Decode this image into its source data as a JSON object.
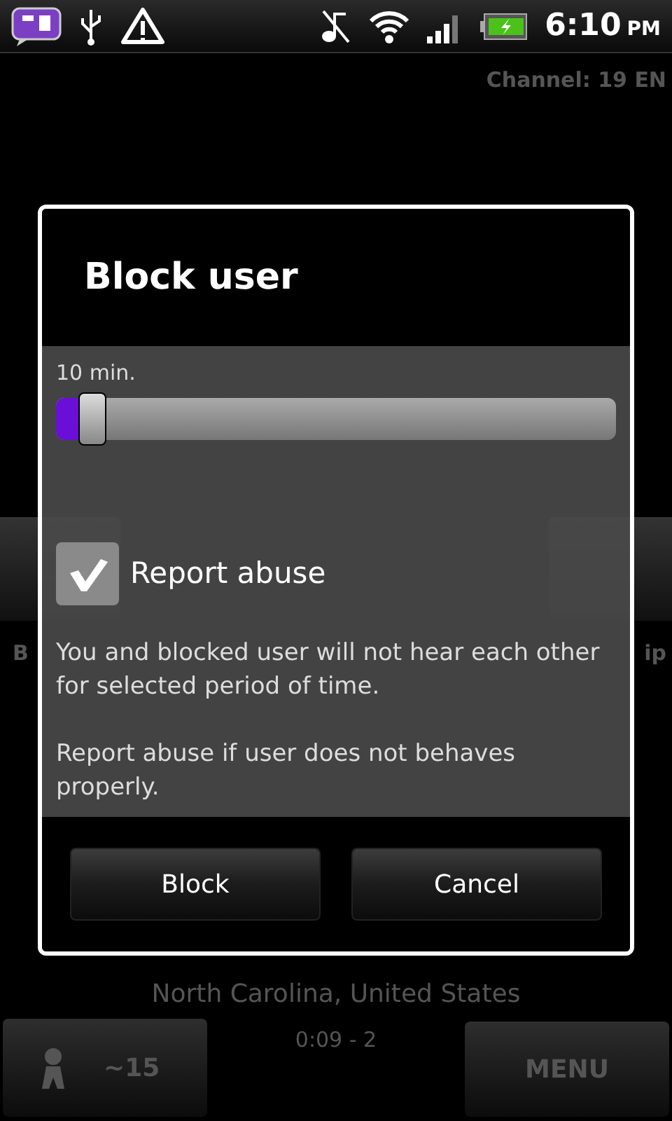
{
  "status_bar": {
    "time": "6:10",
    "ampm": "PM"
  },
  "channel": "Channel: 19 EN",
  "side_buttons": [
    {
      "label": "B"
    },
    {
      "label": "ip"
    }
  ],
  "location": "North Carolina, United States",
  "timer": "0:09 - 2",
  "users_button": {
    "label": "~15"
  },
  "menu_button": {
    "label": "MENU"
  },
  "dialog": {
    "title": "Block user",
    "slider": {
      "label": "10 min.",
      "level": 0.05
    },
    "report": {
      "label": "Report abuse",
      "checked": true
    },
    "paragraphs": [
      "You and blocked user will not hear each other for selected period of time.",
      "Report abuse if user does not behaves properly."
    ],
    "buttons": [
      {
        "label": "Block"
      },
      {
        "label": "Cancel"
      }
    ]
  }
}
